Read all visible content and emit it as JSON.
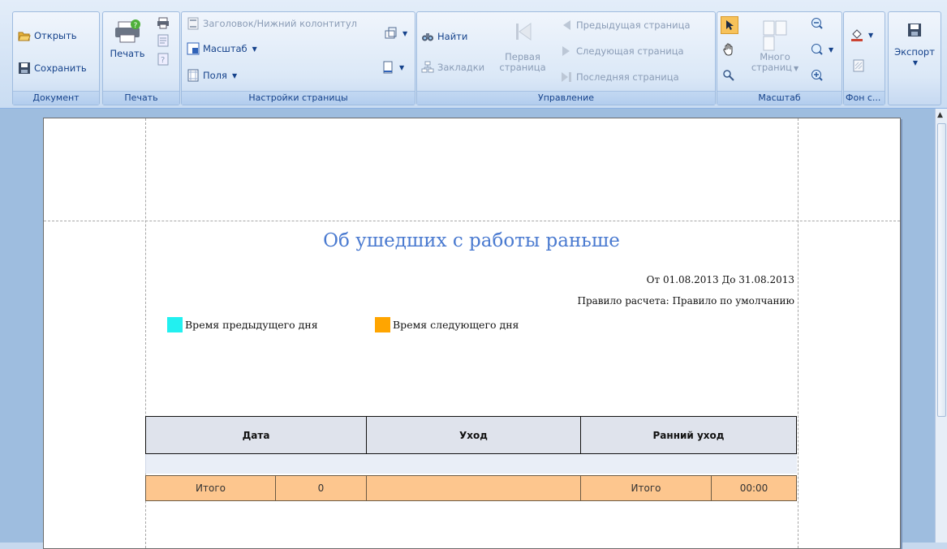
{
  "ribbon": {
    "document": {
      "open": "Открыть",
      "save": "Сохранить",
      "title": "Документ"
    },
    "print": {
      "print": "Печать",
      "title": "Печать"
    },
    "page_setup": {
      "header_footer": "Заголовок/Нижний колонтитул",
      "scale": "Масштаб",
      "margins": "Поля",
      "title": "Настройки страницы"
    },
    "navigation": {
      "find": "Найти",
      "bookmarks": "Закладки",
      "first_page_1": "Первая",
      "first_page_2": "страница",
      "prev_page": "Предыдущая страница",
      "next_page": "Следующая страница",
      "last_page": "Последняя страница",
      "title": "Управление"
    },
    "zoom": {
      "many_pages_1": "Много",
      "many_pages_2": "страниц",
      "title": "Масштаб"
    },
    "background": {
      "title": "Фон с..."
    },
    "export": {
      "label": "Экспорт"
    }
  },
  "report": {
    "title": "Об ушедших с работы раньше",
    "period": "От 01.08.2013 До 31.08.2013",
    "rule": "Правило расчета: Правило по умолчанию",
    "legend": [
      {
        "label": "Время предыдущего дня",
        "color": "#22f0f0"
      },
      {
        "label": "Время следующего дня",
        "color": "#ffa500"
      }
    ],
    "columns": [
      "Дата",
      "Уход",
      "Ранний уход"
    ],
    "totals": {
      "label_left": "Итого",
      "value_left": "0",
      "label_right": "Итого",
      "value_right": "00:00"
    }
  },
  "colors": {
    "accent": "#4a7ad0",
    "header_bg": "#dfe3ec",
    "total_bg": "#fdc68e"
  }
}
